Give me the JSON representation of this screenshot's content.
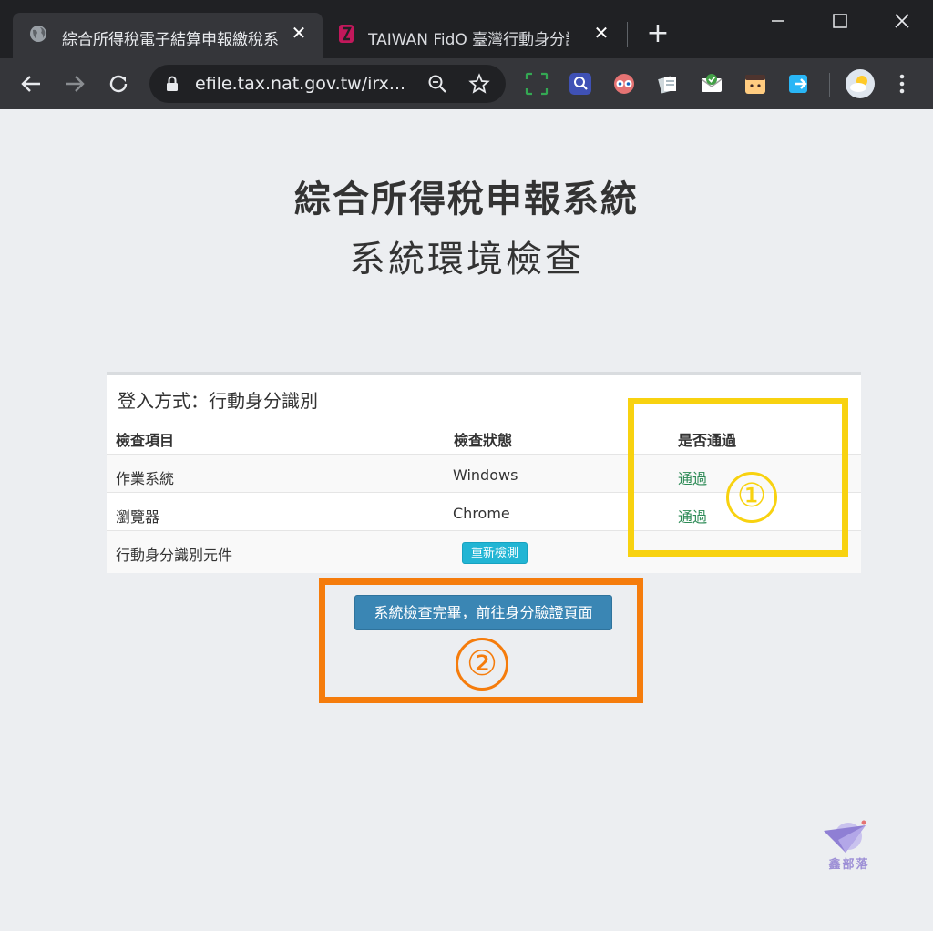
{
  "browser": {
    "tabs": [
      {
        "title": "綜合所得稅電子結算申報繳稅系",
        "icon": "globe-icon",
        "close": "✕"
      },
      {
        "title": "TAIWAN FidO 臺灣行動身分識",
        "icon": "fido-icon",
        "close": "✕"
      }
    ],
    "new_tab": "+",
    "url": "efile.tax.nat.gov.tw/irx...",
    "extensions": [
      "screenshot-icon",
      "search-extension-icon",
      "eyes-extension-icon",
      "notes-extension-icon",
      "mail-check-icon",
      "face-extension-icon",
      "share-extension-icon"
    ]
  },
  "page": {
    "title": "綜合所得稅申報系統",
    "subtitle": "系統環境檢查",
    "panel": {
      "login_method": "登入方式：行動身分識別",
      "headers": {
        "item": "檢查項目",
        "status": "檢查狀態",
        "pass": "是否通過"
      },
      "rows": [
        {
          "item": "作業系統",
          "status": "Windows",
          "pass": "通過"
        },
        {
          "item": "瀏覽器",
          "status": "Chrome",
          "pass": "通過"
        },
        {
          "item": "行動身分識別元件",
          "status": "",
          "pass": ""
        }
      ],
      "recheck_button": "重新檢測"
    },
    "proceed_button": "系統檢查完畢，前往身分驗證頁面",
    "annotations": {
      "badge1": "①",
      "badge2": "②"
    },
    "watermark": "鑫部落"
  },
  "colors": {
    "callout_yellow": "#f8d210",
    "callout_orange": "#f57c0c",
    "pass_green": "#2e8b57",
    "button_blue": "#3a86b4",
    "recheck_cyan": "#22b5d4"
  }
}
